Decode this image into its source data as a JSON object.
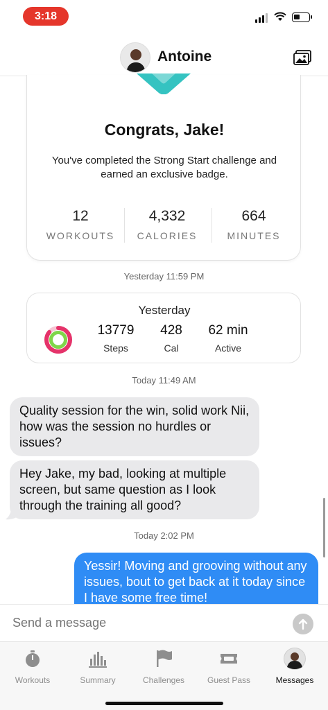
{
  "status_bar": {
    "time": "3:18"
  },
  "header": {
    "contact_name": "Antoine"
  },
  "challenge_card": {
    "title": "Congrats, Jake!",
    "description": "You've completed the Strong Start challenge and earned an exclusive badge.",
    "stats": [
      {
        "value": "12",
        "label": "WORKOUTS"
      },
      {
        "value": "4,332",
        "label": "CALORIES"
      },
      {
        "value": "664",
        "label": "MINUTES"
      }
    ]
  },
  "timestamps": [
    "Yesterday 11:59 PM",
    "Today 11:49 AM",
    "Today 2:02 PM"
  ],
  "activity_card": {
    "title": "Yesterday",
    "metrics": [
      {
        "value": "13779",
        "label": "Steps"
      },
      {
        "value": "428",
        "label": "Cal"
      },
      {
        "value": "62 min",
        "label": "Active"
      }
    ],
    "ring_colors": {
      "move": "#e5336a",
      "exercise": "#7fd64a",
      "stand": "#ffffff"
    }
  },
  "messages": [
    {
      "direction": "incoming",
      "text": "Quality session for the win, solid work Nii, how was the session no hurdles or issues?"
    },
    {
      "direction": "incoming",
      "text": "Hey Jake, my bad, looking at multiple screen, but same question as I look through the training all good?"
    },
    {
      "direction": "outgoing",
      "text": "Yessir! Moving and grooving without any issues, bout to get back at it today since I have some free time!"
    }
  ],
  "composer": {
    "placeholder": "Send a message"
  },
  "tab_bar": {
    "tabs": [
      {
        "label": "Workouts",
        "icon": "stopwatch-icon"
      },
      {
        "label": "Summary",
        "icon": "bar-chart-icon"
      },
      {
        "label": "Challenges",
        "icon": "flag-icon"
      },
      {
        "label": "Guest Pass",
        "icon": "ticket-icon"
      },
      {
        "label": "Messages",
        "icon": "avatar-icon"
      }
    ],
    "active": "Messages"
  },
  "colors": {
    "accent": "#2f8cf5",
    "time_pill": "#e5362b",
    "badge": "#35c3c1"
  }
}
